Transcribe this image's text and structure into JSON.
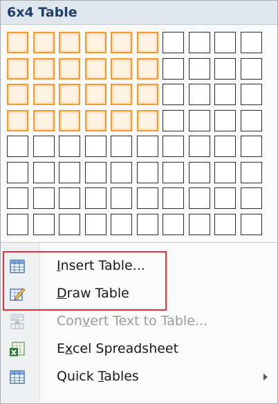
{
  "header": {
    "title": "6x4 Table"
  },
  "grid": {
    "columns": 10,
    "rows": 8,
    "selected_columns": 6,
    "selected_rows": 4
  },
  "menu_items": [
    {
      "id": "insert-table",
      "pre": "",
      "accel": "I",
      "post": "nsert Table...",
      "icon": "table-grid-icon",
      "disabled": false,
      "submenu": false
    },
    {
      "id": "draw-table",
      "pre": "",
      "accel": "D",
      "post": "raw Table",
      "icon": "pencil-table-icon",
      "disabled": false,
      "submenu": false
    },
    {
      "id": "convert-text-to-table",
      "pre": "Con",
      "accel": "v",
      "post": "ert Text to Table...",
      "icon": "convert-text-icon",
      "disabled": true,
      "submenu": false
    },
    {
      "id": "excel-spreadsheet",
      "pre": "E",
      "accel": "x",
      "post": "cel Spreadsheet",
      "icon": "excel-icon",
      "disabled": false,
      "submenu": false
    },
    {
      "id": "quick-tables",
      "pre": "Quick ",
      "accel": "T",
      "post": "ables",
      "icon": "quick-tables-icon",
      "disabled": false,
      "submenu": true
    }
  ],
  "colors": {
    "highlight_border": "#f29b2f",
    "annotation_box": "#e0303a"
  }
}
